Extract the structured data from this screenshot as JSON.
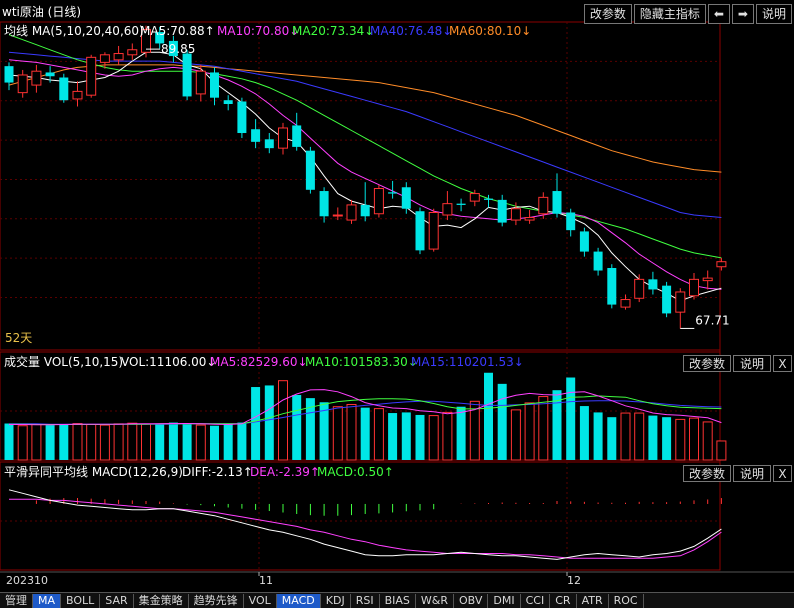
{
  "title": "wti原油 (日线)",
  "toolbar": {
    "params": "改参数",
    "hide_indicator": "隐藏主指标",
    "prev": "⬅",
    "next": "➡",
    "help": "说明"
  },
  "main_legend": {
    "label": "均线 MA(5,10,20,40,60)",
    "ma5": "MA5:70.88↑",
    "ma10": "MA10:70.80↓",
    "ma20": "MA20:73.34↓",
    "ma40": "MA40:76.48↓",
    "ma60": "MA60:80.10↓"
  },
  "colors": {
    "up": "#ff3232",
    "down": "#00e6e6",
    "ma5": "#ffffff",
    "ma10": "#ff40ff",
    "ma20": "#40ff40",
    "ma40": "#3a3aff",
    "ma60": "#ff8c28",
    "grid": "#5a0000",
    "border": "#8b0000"
  },
  "days_label": "52天",
  "volume_legend": {
    "label": "成交量 VOL(5,10,15)",
    "vol": "VOL:11106.00↓",
    "ma5": "MA5:82529.60↓",
    "ma10": "MA10:101583.30↓",
    "ma15": "MA15:110201.53↓"
  },
  "macd_legend": {
    "label": "平滑异同平均线 MACD(12,26,9)",
    "diff": "DIFF:-2.13↑",
    "dea": "DEA:-2.39↑",
    "macd": "MACD:0.50↑"
  },
  "panel_buttons": {
    "params": "改参数",
    "help": "说明",
    "close": "X"
  },
  "x_axis_labels": [
    "202310",
    "11",
    "12"
  ],
  "tabs": [
    "管理",
    "MA",
    "BOLL",
    "SAR",
    "集金策略",
    "趋势先锋",
    "VOL",
    "MACD",
    "KDJ",
    "RSI",
    "BIAS",
    "W&R",
    "OBV",
    "DMI",
    "CCI",
    "CR",
    "ATR",
    "ROC"
  ],
  "active_tabs": [
    "MA",
    "MACD"
  ],
  "chart_data": {
    "type": "candlestick",
    "price_range": [
      66,
      92
    ],
    "max_marker": 89.85,
    "min_marker": 67.71,
    "candles": [
      [
        88.5,
        87.2,
        88.8,
        86.6
      ],
      [
        86.4,
        87.8,
        88.2,
        86.0
      ],
      [
        87.0,
        88.1,
        88.6,
        86.4
      ],
      [
        88.0,
        87.7,
        88.5,
        87.2
      ],
      [
        87.6,
        85.8,
        87.9,
        85.6
      ],
      [
        85.9,
        86.5,
        87.3,
        85.3
      ],
      [
        86.2,
        89.2,
        89.4,
        86.0
      ],
      [
        88.8,
        89.4,
        89.6,
        88.3
      ],
      [
        89.0,
        89.5,
        90.1,
        88.6
      ],
      [
        89.4,
        89.8,
        90.3,
        89.0
      ],
      [
        89.6,
        91.4,
        91.7,
        89.2
      ],
      [
        91.2,
        90.3,
        91.6,
        89.9
      ],
      [
        90.5,
        89.3,
        90.9,
        88.8
      ],
      [
        89.5,
        86.1,
        89.8,
        85.8
      ],
      [
        86.3,
        88.1,
        88.6,
        85.7
      ],
      [
        88.0,
        86.0,
        88.4,
        85.4
      ],
      [
        85.8,
        85.5,
        86.2,
        85.0
      ],
      [
        85.7,
        83.2,
        86.0,
        82.8
      ],
      [
        83.5,
        82.5,
        84.3,
        82.0
      ],
      [
        82.7,
        82.0,
        83.2,
        81.6
      ],
      [
        82.0,
        83.6,
        84.0,
        81.5
      ],
      [
        83.8,
        82.1,
        84.8,
        81.8
      ],
      [
        81.8,
        78.7,
        82.1,
        78.4
      ],
      [
        78.6,
        76.6,
        78.9,
        76.1
      ],
      [
        76.7,
        76.7,
        77.3,
        76.3
      ],
      [
        76.3,
        77.5,
        77.9,
        76.0
      ],
      [
        77.5,
        76.6,
        79.3,
        76.2
      ],
      [
        76.8,
        78.8,
        79.1,
        76.5
      ],
      [
        78.5,
        78.4,
        79.4,
        78.0
      ],
      [
        78.9,
        77.2,
        79.3,
        76.8
      ],
      [
        77.0,
        73.9,
        77.3,
        73.6
      ],
      [
        74.0,
        76.9,
        77.2,
        73.8
      ],
      [
        76.7,
        77.6,
        78.6,
        76.3
      ],
      [
        77.6,
        77.5,
        78.0,
        77.0
      ],
      [
        77.8,
        78.4,
        78.7,
        77.4
      ],
      [
        78.0,
        77.9,
        78.3,
        77.3
      ],
      [
        77.9,
        76.1,
        78.3,
        75.8
      ],
      [
        76.3,
        77.2,
        77.7,
        75.9
      ],
      [
        76.3,
        76.5,
        77.1,
        76.0
      ],
      [
        76.8,
        78.1,
        78.5,
        76.4
      ],
      [
        78.6,
        76.8,
        80.0,
        76.5
      ],
      [
        76.9,
        75.5,
        77.2,
        75.0
      ],
      [
        75.4,
        73.8,
        75.7,
        73.4
      ],
      [
        73.8,
        72.3,
        74.1,
        71.9
      ],
      [
        72.5,
        69.6,
        72.8,
        69.3
      ],
      [
        69.4,
        70.0,
        70.4,
        69.2
      ],
      [
        70.1,
        71.6,
        72.0,
        69.8
      ],
      [
        71.6,
        70.8,
        72.2,
        70.4
      ],
      [
        71.1,
        68.9,
        71.4,
        68.6
      ],
      [
        69.0,
        70.6,
        70.9,
        67.7
      ],
      [
        70.3,
        71.6,
        72.1,
        70.0
      ],
      [
        71.5,
        71.7,
        72.3,
        70.8
      ],
      [
        72.6,
        73.0,
        73.3,
        72.3
      ]
    ],
    "ma5": [
      87.8,
      87.7,
      87.6,
      87.4,
      87.3,
      87.2,
      87.4,
      87.6,
      88.1,
      88.9,
      89.6,
      89.6,
      89.4,
      88.6,
      88.3,
      87.2,
      86.4,
      85.6,
      84.7,
      83.6,
      82.8,
      82.5,
      81.3,
      79.8,
      78.4,
      77.8,
      77.5,
      77.2,
      77.4,
      77.3,
      76.5,
      75.8,
      75.9,
      75.7,
      76.4,
      77.3,
      77.1,
      77.3,
      77.4,
      77.0,
      76.9,
      76.5,
      76.0,
      75.1,
      73.7,
      72.6,
      71.6,
      71.0,
      70.5,
      69.9,
      70.3,
      70.6,
      70.9
    ],
    "ma10": [
      89.0,
      88.9,
      88.8,
      88.6,
      88.4,
      88.2,
      88.0,
      87.8,
      87.7,
      87.8,
      88.1,
      88.3,
      88.4,
      88.3,
      88.1,
      87.8,
      87.4,
      86.9,
      86.3,
      85.5,
      84.6,
      83.8,
      82.8,
      81.8,
      80.8,
      80.1,
      79.6,
      79.1,
      78.6,
      78.1,
      77.5,
      77.0,
      76.8,
      76.6,
      76.5,
      76.4,
      76.3,
      76.4,
      76.5,
      76.7,
      76.9,
      76.8,
      76.6,
      76.1,
      75.3,
      74.5,
      73.6,
      72.9,
      72.2,
      71.6,
      71.1,
      70.9,
      70.8
    ],
    "ma20": [
      91.0,
      90.6,
      90.2,
      89.8,
      89.4,
      89.0,
      88.7,
      88.4,
      88.2,
      88.1,
      88.1,
      88.1,
      88.1,
      88.1,
      88.0,
      87.9,
      87.7,
      87.5,
      87.2,
      86.8,
      86.3,
      85.8,
      85.2,
      84.6,
      84.0,
      83.4,
      82.8,
      82.2,
      81.6,
      81.0,
      80.4,
      79.8,
      79.3,
      78.8,
      78.4,
      78.0,
      77.7,
      77.4,
      77.2,
      77.0,
      76.9,
      76.7,
      76.5,
      76.2,
      75.9,
      75.6,
      75.2,
      74.8,
      74.4,
      74.0,
      73.7,
      73.5,
      73.3
    ],
    "ma40": [
      89.6,
      89.5,
      89.4,
      89.3,
      89.2,
      89.1,
      89.0,
      88.9,
      88.9,
      88.9,
      88.9,
      88.9,
      88.8,
      88.7,
      88.6,
      88.5,
      88.3,
      88.1,
      87.9,
      87.7,
      87.5,
      87.3,
      87.0,
      86.7,
      86.4,
      86.1,
      85.8,
      85.5,
      85.2,
      84.9,
      84.5,
      84.1,
      83.7,
      83.3,
      82.9,
      82.5,
      82.1,
      81.7,
      81.3,
      80.9,
      80.5,
      80.1,
      79.7,
      79.3,
      78.9,
      78.5,
      78.1,
      77.7,
      77.3,
      76.9,
      76.7,
      76.6,
      76.5
    ],
    "ma60": [
      87.0,
      87.3,
      87.6,
      87.9,
      88.2,
      88.4,
      88.5,
      88.6,
      88.6,
      88.6,
      88.6,
      88.6,
      88.6,
      88.5,
      88.5,
      88.4,
      88.3,
      88.2,
      88.1,
      88.0,
      87.9,
      87.8,
      87.7,
      87.6,
      87.5,
      87.4,
      87.3,
      87.2,
      87.0,
      86.8,
      86.6,
      86.4,
      86.1,
      85.8,
      85.5,
      85.2,
      84.9,
      84.6,
      84.2,
      83.8,
      83.4,
      83.0,
      82.6,
      82.2,
      81.8,
      81.5,
      81.2,
      80.9,
      80.7,
      80.5,
      80.3,
      80.2,
      80.1
    ],
    "volume": [
      115,
      108,
      112,
      110,
      113,
      115,
      112,
      110,
      114,
      116,
      113,
      115,
      118,
      112,
      110,
      108,
      112,
      118,
      230,
      235,
      250,
      205,
      195,
      182,
      168,
      175,
      165,
      162,
      148,
      150,
      142,
      140,
      150,
      168,
      185,
      275,
      240,
      158,
      180,
      200,
      220,
      260,
      170,
      150,
      135,
      148,
      148,
      140,
      135,
      128,
      132,
      120,
      60
    ],
    "vol_ma5": [
      112,
      112,
      111,
      111,
      112,
      113,
      113,
      113,
      113,
      114,
      114,
      114,
      115,
      115,
      114,
      113,
      112,
      114,
      136,
      160,
      189,
      208,
      221,
      222,
      215,
      200,
      181,
      171,
      164,
      162,
      155,
      152,
      146,
      150,
      159,
      176,
      193,
      204,
      210,
      206,
      205,
      213,
      215,
      202,
      187,
      171,
      160,
      148,
      143,
      141,
      137,
      133,
      118
    ],
    "vol_ma10": [
      113,
      113,
      112,
      112,
      112,
      112,
      112,
      112,
      113,
      113,
      113,
      114,
      114,
      114,
      114,
      114,
      114,
      114,
      123,
      133,
      146,
      156,
      166,
      176,
      184,
      188,
      191,
      193,
      193,
      192,
      187,
      178,
      168,
      161,
      161,
      163,
      167,
      172,
      177,
      182,
      187,
      198,
      199,
      202,
      200,
      198,
      187,
      177,
      171,
      166,
      165,
      163,
      162
    ],
    "vol_ma15": [
      114,
      114,
      114,
      113,
      113,
      113,
      113,
      113,
      113,
      113,
      113,
      113,
      113,
      114,
      114,
      114,
      114,
      114,
      120,
      127,
      134,
      142,
      149,
      156,
      164,
      168,
      172,
      176,
      180,
      183,
      185,
      185,
      182,
      179,
      175,
      172,
      172,
      174,
      175,
      177,
      180,
      184,
      186,
      187,
      187,
      186,
      183,
      180,
      176,
      172,
      170,
      168,
      167
    ],
    "macd_hist": [
      0,
      0,
      0.3,
      0.45,
      0.5,
      0.5,
      0.45,
      0.4,
      0.35,
      0.3,
      0.25,
      0.2,
      0.05,
      -0.05,
      -0.1,
      -0.2,
      -0.3,
      -0.4,
      -0.5,
      -0.6,
      -0.72,
      -0.85,
      -0.95,
      -1.0,
      -1.0,
      -0.95,
      -0.85,
      -0.8,
      -0.72,
      -0.62,
      -0.55,
      -0.45,
      0.0,
      0.03,
      0.05,
      0.08,
      0.12,
      0.1,
      0.08,
      0.08,
      0.25,
      0.22,
      0.18,
      0.12,
      0.1,
      0.1,
      0.18,
      0.15,
      0.15,
      0.2,
      0.3,
      0.38,
      0.5
    ],
    "macd_diff": [
      1.2,
      0.9,
      0.6,
      0.3,
      0.1,
      -0.1,
      -0.2,
      -0.3,
      -0.4,
      -0.5,
      -0.5,
      -0.4,
      -0.4,
      -0.6,
      -0.8,
      -1.0,
      -1.3,
      -1.6,
      -1.9,
      -2.2,
      -2.4,
      -2.7,
      -3.0,
      -3.4,
      -3.7,
      -4.0,
      -4.3,
      -4.4,
      -4.4,
      -4.3,
      -4.3,
      -4.3,
      -4.2,
      -4.1,
      -4.2,
      -4.3,
      -4.4,
      -4.4,
      -4.5,
      -4.6,
      -4.7,
      -4.5,
      -4.3,
      -4.2,
      -4.3,
      -4.4,
      -4.5,
      -4.3,
      -4.2,
      -4.0,
      -3.6,
      -2.9,
      -2.13
    ],
    "macd_dea": [
      0.4,
      0.4,
      0.4,
      0.3,
      0.3,
      0.2,
      0.1,
      0.0,
      -0.1,
      -0.2,
      -0.3,
      -0.4,
      -0.4,
      -0.5,
      -0.6,
      -0.7,
      -0.9,
      -1.1,
      -1.3,
      -1.5,
      -1.7,
      -1.9,
      -2.2,
      -2.4,
      -2.7,
      -3.0,
      -3.2,
      -3.5,
      -3.7,
      -3.9,
      -4.0,
      -4.1,
      -4.2,
      -4.2,
      -4.2,
      -4.2,
      -4.2,
      -4.3,
      -4.3,
      -4.4,
      -4.5,
      -4.6,
      -4.6,
      -4.6,
      -4.6,
      -4.6,
      -4.6,
      -4.6,
      -4.5,
      -4.4,
      -3.9,
      -3.2,
      -2.39
    ],
    "macd_range": [
      -5.6,
      2.2
    ]
  }
}
